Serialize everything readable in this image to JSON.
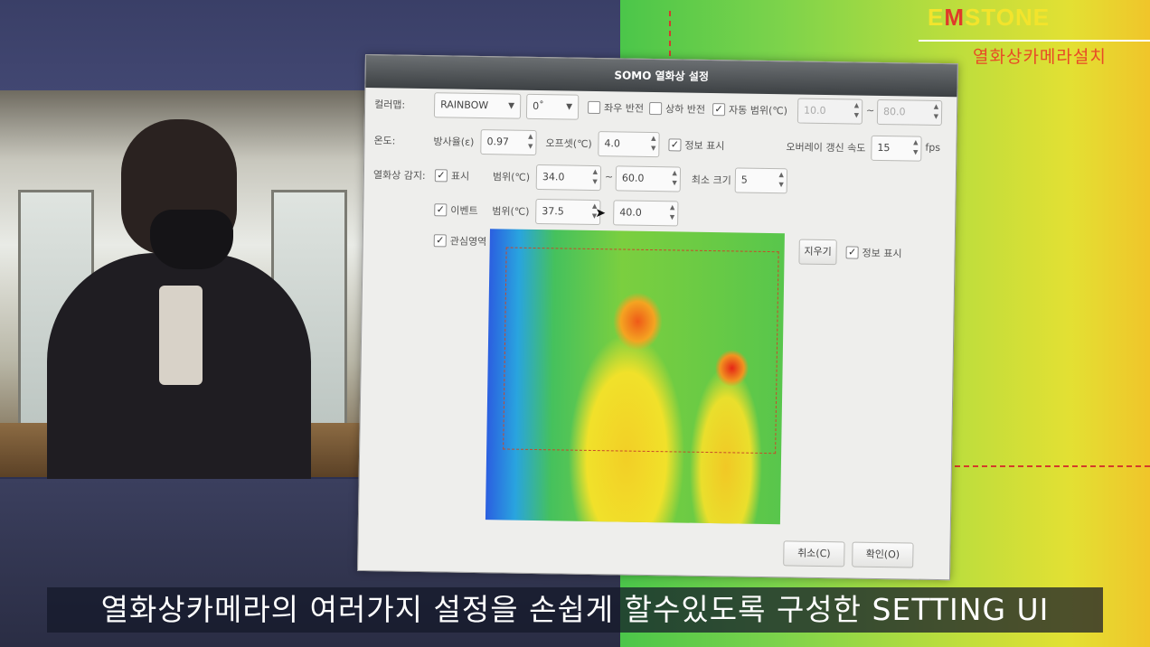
{
  "brand": {
    "name_prefix": "E",
    "name_m": "M",
    "name_suffix": "STONE",
    "subtitle": "열화상카메라설치"
  },
  "dialog": {
    "title": "SOMO 열화상 설정",
    "row_colormap": {
      "label": "컬러맵:",
      "colormap_value": "RAINBOW",
      "rotation_value": "0˚",
      "flip_h_label": "좌우 반전",
      "flip_h_checked": false,
      "flip_v_label": "상하 반전",
      "flip_v_checked": false,
      "auto_range_label": "자동 범위(℃)",
      "auto_range_checked": true,
      "range_min": "10.0",
      "range_sep": "~",
      "range_max": "80.0"
    },
    "row_temp": {
      "label": "온도:",
      "emissivity_label": "방사율(ε)",
      "emissivity_value": "0.97",
      "offset_label": "오프셋(℃)",
      "offset_value": "4.0",
      "info_label": "정보 표시",
      "info_checked": true,
      "overlay_label": "오버레이 갱신 속도",
      "overlay_value": "15",
      "overlay_unit": "fps"
    },
    "row_detect": {
      "label": "열화상 감지:",
      "show_label": "표시",
      "show_checked": true,
      "range_label": "범위(℃)",
      "range_min": "34.0",
      "range_sep": "~",
      "range_max": "60.0",
      "min_size_label": "최소 크기",
      "min_size_value": "5"
    },
    "row_event": {
      "event_label": "이벤트",
      "event_checked": true,
      "range_label": "범위(℃)",
      "range_min": "37.5",
      "range_max": "40.0"
    },
    "row_roi": {
      "roi_label": "관심영역",
      "roi_checked": true,
      "clear_label": "지우기",
      "info_label": "정보 표시",
      "info_checked": true
    },
    "cancel_label": "취소(C)",
    "ok_label": "확인(O)"
  },
  "subtitle": "열화상카메라의 여러가지 설정을 손쉽게 할수있도록 구성한 SETTING UI",
  "colors": {
    "titlebar": "#4a4e51",
    "dialog_bg": "#eeeeec",
    "brand_yellow": "#f3e42c",
    "brand_red": "#e03a2a"
  },
  "icons": [
    "chevron-down-icon",
    "spin-arrows-icon",
    "checkmark-icon",
    "mouse-cursor-icon"
  ]
}
